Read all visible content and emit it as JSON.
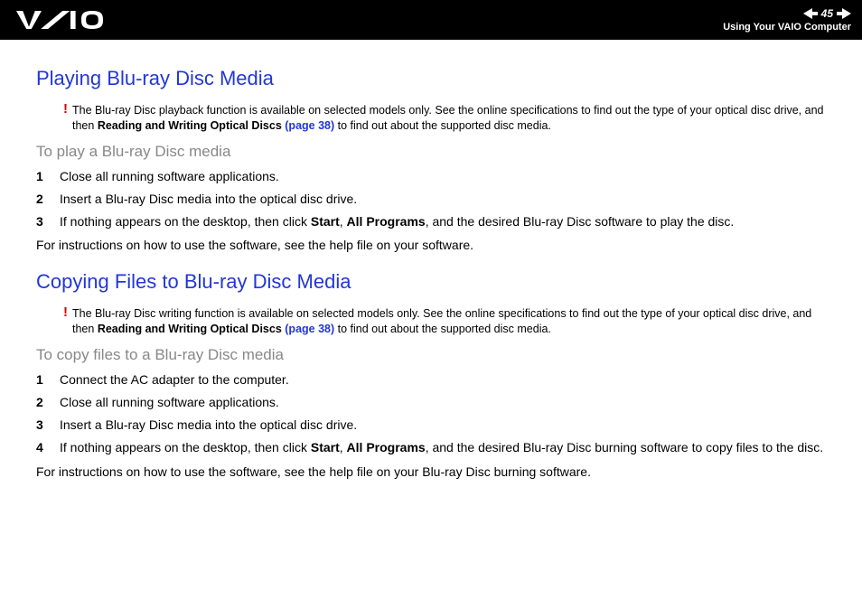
{
  "header": {
    "page_number": "45",
    "breadcrumb": "Using Your VAIO Computer"
  },
  "section1": {
    "title": "Playing Blu-ray Disc Media",
    "warn_mark": "!",
    "warn_pre": "The Blu-ray Disc playback function is available on selected models only. See the online specifications to find out the type of your optical disc drive, and then ",
    "warn_bold": "Reading and Writing Optical Discs ",
    "warn_link": "(page 38)",
    "warn_post": " to find out about the supported disc media.",
    "subtitle": "To play a Blu-ray Disc media",
    "steps": [
      {
        "n": "1",
        "t_plain": "Close all running software applications."
      },
      {
        "n": "2",
        "t_plain": "Insert a Blu-ray Disc media into the optical disc drive."
      },
      {
        "n": "3",
        "t_pre": "If nothing appears on the desktop, then click ",
        "t_b1": "Start",
        "t_mid1": ", ",
        "t_b2": "All Programs",
        "t_post": ", and the desired Blu-ray Disc software to play the disc."
      }
    ],
    "after": "For instructions on how to use the software, see the help file on your software."
  },
  "section2": {
    "title": "Copying Files to Blu-ray Disc Media",
    "warn_mark": "!",
    "warn_pre": "The Blu-ray Disc writing function is available on selected models only. See the online specifications to find out the type of your optical disc drive, and then ",
    "warn_bold": "Reading and Writing Optical Discs ",
    "warn_link": "(page 38)",
    "warn_post": " to find out about the supported disc media.",
    "subtitle": "To copy files to a Blu-ray Disc media",
    "steps": [
      {
        "n": "1",
        "t_plain": "Connect the AC adapter to the computer."
      },
      {
        "n": "2",
        "t_plain": "Close all running software applications."
      },
      {
        "n": "3",
        "t_plain": "Insert a Blu-ray Disc media into the optical disc drive."
      },
      {
        "n": "4",
        "t_pre": "If nothing appears on the desktop, then click ",
        "t_b1": "Start",
        "t_mid1": ", ",
        "t_b2": "All Programs",
        "t_post": ", and the desired Blu-ray Disc burning software to copy files to the disc."
      }
    ],
    "after": "For instructions on how to use the software, see the help file on your Blu-ray Disc burning software."
  }
}
